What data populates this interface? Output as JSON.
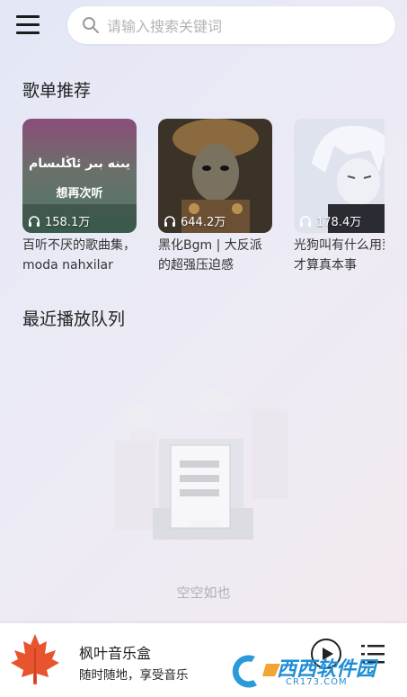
{
  "search": {
    "placeholder": "请输入搜索关键词"
  },
  "sections": {
    "recommend_title": "歌单推荐",
    "queue_title": "最近播放队列"
  },
  "playlists": [
    {
      "plays": "158.1万",
      "name": "百听不厌的歌曲集，moda nahxilar",
      "cover_text_1": "يىنە بىر ئاڭلىسام",
      "cover_text_2": "想再次听"
    },
    {
      "plays": "644.2万",
      "name": "黑化Bgm | 大反派的超强压迫感"
    },
    {
      "plays": "178.4万",
      "name": "光狗叫有什么用到我才算真本事"
    }
  ],
  "queue": {
    "empty_text": "空空如也"
  },
  "player": {
    "title": "枫叶音乐盒",
    "subtitle": "随时随地，享受音乐"
  },
  "watermark": {
    "site": "西西软件园",
    "url": "CR173.COM"
  },
  "colors": {
    "maple": "#e8542e",
    "accent_bg_start": "#e3e7f6",
    "accent_bg_end": "#f4e9ef"
  }
}
